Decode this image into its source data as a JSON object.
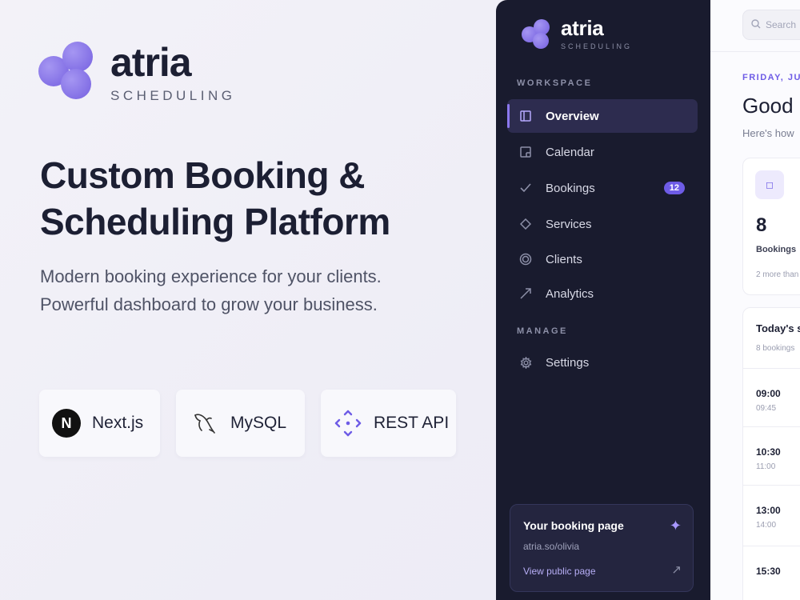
{
  "hero": {
    "brand_name": "atria",
    "brand_sub": "SCHEDULING",
    "title_line1": "Custom Booking &",
    "title_line2": "Scheduling Platform",
    "description": "Modern booking experience for your clients. Powerful dashboard to grow your business.",
    "tech": [
      {
        "label": "Next.js",
        "icon": "nextjs-icon"
      },
      {
        "label": "MySQL",
        "icon": "mysql-dolphin-icon"
      },
      {
        "label": "REST API",
        "icon": "api-icon"
      }
    ]
  },
  "sidebar": {
    "brand_name": "atria",
    "brand_sub": "SCHEDULING",
    "workspace_label": "WORKSPACE",
    "manage_label": "MANAGE",
    "items": [
      {
        "label": "Overview",
        "icon": "overview-icon",
        "active": true
      },
      {
        "label": "Calendar",
        "icon": "calendar-icon"
      },
      {
        "label": "Bookings",
        "icon": "check-icon",
        "badge": "12"
      },
      {
        "label": "Services",
        "icon": "diamond-icon"
      },
      {
        "label": "Clients",
        "icon": "clients-icon"
      },
      {
        "label": "Analytics",
        "icon": "trend-icon"
      },
      {
        "label": "Settings",
        "icon": "gear-icon"
      }
    ],
    "booking_page": {
      "title": "Your booking page",
      "url": "atria.so/olivia",
      "link": "View public page"
    }
  },
  "main": {
    "search_placeholder": "Search",
    "date": "FRIDAY, JU",
    "greeting": "Good",
    "greeting_sub": "Here's how",
    "stat": {
      "value": "8",
      "label": "Bookings",
      "more": "2 more than"
    },
    "schedule": {
      "title": "Today's s",
      "subtitle": "8 bookings",
      "slots": [
        {
          "start": "09:00",
          "end": "09:45"
        },
        {
          "start": "10:30",
          "end": "11:00"
        },
        {
          "start": "13:00",
          "end": "14:00"
        },
        {
          "start": "15:30",
          "end": ""
        }
      ]
    }
  },
  "colors": {
    "accent": "#6e5ce6",
    "sidebar_bg": "#191b2e",
    "text_dark": "#1c1f33"
  }
}
